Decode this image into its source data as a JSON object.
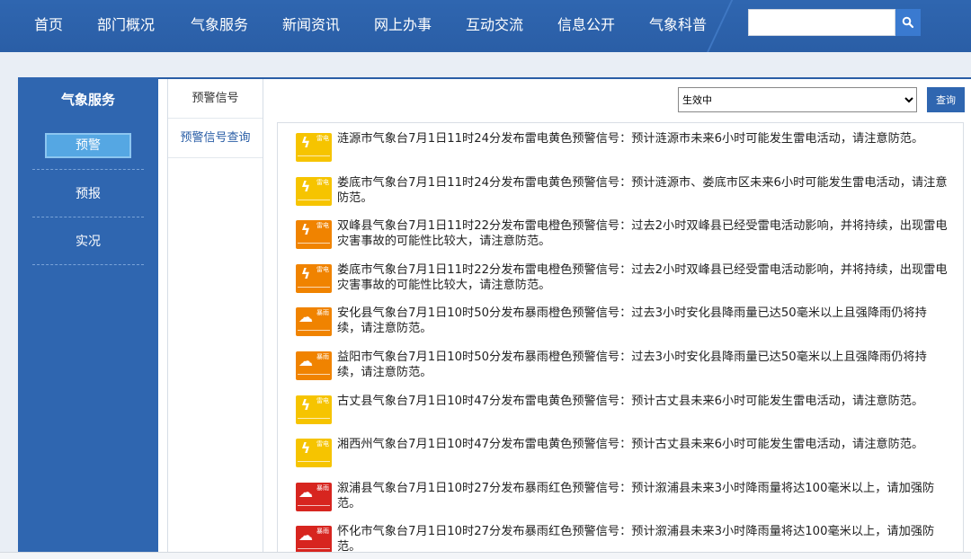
{
  "nav": {
    "items": [
      "首页",
      "部门概况",
      "气象服务",
      "新闻资讯",
      "网上办事",
      "互动交流",
      "信息公开",
      "气象科普"
    ],
    "search_placeholder": "",
    "search_value": ""
  },
  "sidebar": {
    "title": "气象服务",
    "items": [
      "预警",
      "预报",
      "实况"
    ],
    "active_item": "预警"
  },
  "subnav": {
    "items": [
      "预警信号",
      "预警信号查询"
    ]
  },
  "filter": {
    "status_value": "生效中",
    "query_label": "查询"
  },
  "colors": {
    "nav_bg": "#2f66b0",
    "yellow": "#f6c400",
    "orange": "#f08300",
    "red": "#d7251f"
  },
  "warnings": [
    {
      "type": "thunder",
      "level": "yellow",
      "icon": "thunder-yellow-icon",
      "icon_label": "雷电",
      "icon_level": "黄",
      "text": "涟源市气象台7月1日11时24分发布雷电黄色预警信号：预计涟源市未来6小时可能发生雷电活动，请注意防范。"
    },
    {
      "type": "thunder",
      "level": "yellow",
      "icon": "thunder-yellow-icon",
      "icon_label": "雷电",
      "icon_level": "黄",
      "text": "娄底市气象台7月1日11时24分发布雷电黄色预警信号：预计涟源市、娄底市区未来6小时可能发生雷电活动，请注意防范。"
    },
    {
      "type": "thunder",
      "level": "orange",
      "icon": "thunder-orange-icon",
      "icon_label": "雷电",
      "icon_level": "橙",
      "text": "双峰县气象台7月1日11时22分发布雷电橙色预警信号：过去2小时双峰县已经受雷电活动影响，并将持续，出现雷电灾害事故的可能性比较大，请注意防范。"
    },
    {
      "type": "thunder",
      "level": "orange",
      "icon": "thunder-orange-icon",
      "icon_label": "雷电",
      "icon_level": "橙",
      "text": "娄底市气象台7月1日11时22分发布雷电橙色预警信号：过去2小时双峰县已经受雷电活动影响，并将持续，出现雷电灾害事故的可能性比较大，请注意防范。"
    },
    {
      "type": "rain",
      "level": "orange",
      "icon": "rainstorm-orange-icon",
      "icon_label": "暴雨",
      "icon_level": "橙",
      "text": "安化县气象台7月1日10时50分发布暴雨橙色预警信号：过去3小时安化县降雨量已达50毫米以上且强降雨仍将持续，请注意防范。"
    },
    {
      "type": "rain",
      "level": "orange",
      "icon": "rainstorm-orange-icon",
      "icon_label": "暴雨",
      "icon_level": "橙",
      "text": "益阳市气象台7月1日10时50分发布暴雨橙色预警信号：过去3小时安化县降雨量已达50毫米以上且强降雨仍将持续，请注意防范。"
    },
    {
      "type": "thunder",
      "level": "yellow",
      "icon": "thunder-yellow-icon",
      "icon_label": "雷电",
      "icon_level": "黄",
      "text": "古丈县气象台7月1日10时47分发布雷电黄色预警信号：预计古丈县未来6小时可能发生雷电活动，请注意防范。"
    },
    {
      "type": "thunder",
      "level": "yellow",
      "icon": "thunder-yellow-icon",
      "icon_label": "雷电",
      "icon_level": "黄",
      "text": "湘西州气象台7月1日10时47分发布雷电黄色预警信号：预计古丈县未来6小时可能发生雷电活动，请注意防范。"
    },
    {
      "type": "rain",
      "level": "red",
      "icon": "rainstorm-red-icon",
      "icon_label": "暴雨",
      "icon_level": "红",
      "text": "溆浦县气象台7月1日10时27分发布暴雨红色预警信号：预计溆浦县未来3小时降雨量将达100毫米以上，请加强防范。"
    },
    {
      "type": "rain",
      "level": "red",
      "icon": "rainstorm-red-icon",
      "icon_label": "暴雨",
      "icon_level": "红",
      "text": "怀化市气象台7月1日10时27分发布暴雨红色预警信号：预计溆浦县未来3小时降雨量将达100毫米以上，请加强防范。"
    }
  ]
}
